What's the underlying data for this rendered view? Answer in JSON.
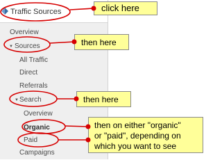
{
  "sidebar": {
    "top_item": "Traffic Sources",
    "items": {
      "overview": "Overview",
      "sources": "Sources",
      "all_traffic": "All Traffic",
      "direct": "Direct",
      "referrals": "Referrals",
      "search": "Search",
      "search_overview": "Overview",
      "organic": "Organic",
      "paid": "Paid",
      "campaigns": "Campaigns"
    }
  },
  "callouts": {
    "step1": "click here",
    "step2": "then here",
    "step3": "then here",
    "step4": "then on either \"organic\"\nor \"paid\", depending on\nwhich you want to see"
  },
  "colors": {
    "annotation_red": "#d60000",
    "callout_fill": "#ffff99",
    "sidebar_bg": "#efefef"
  },
  "icons": [
    "traffic-sources-icon",
    "expand-arrow-icon"
  ]
}
